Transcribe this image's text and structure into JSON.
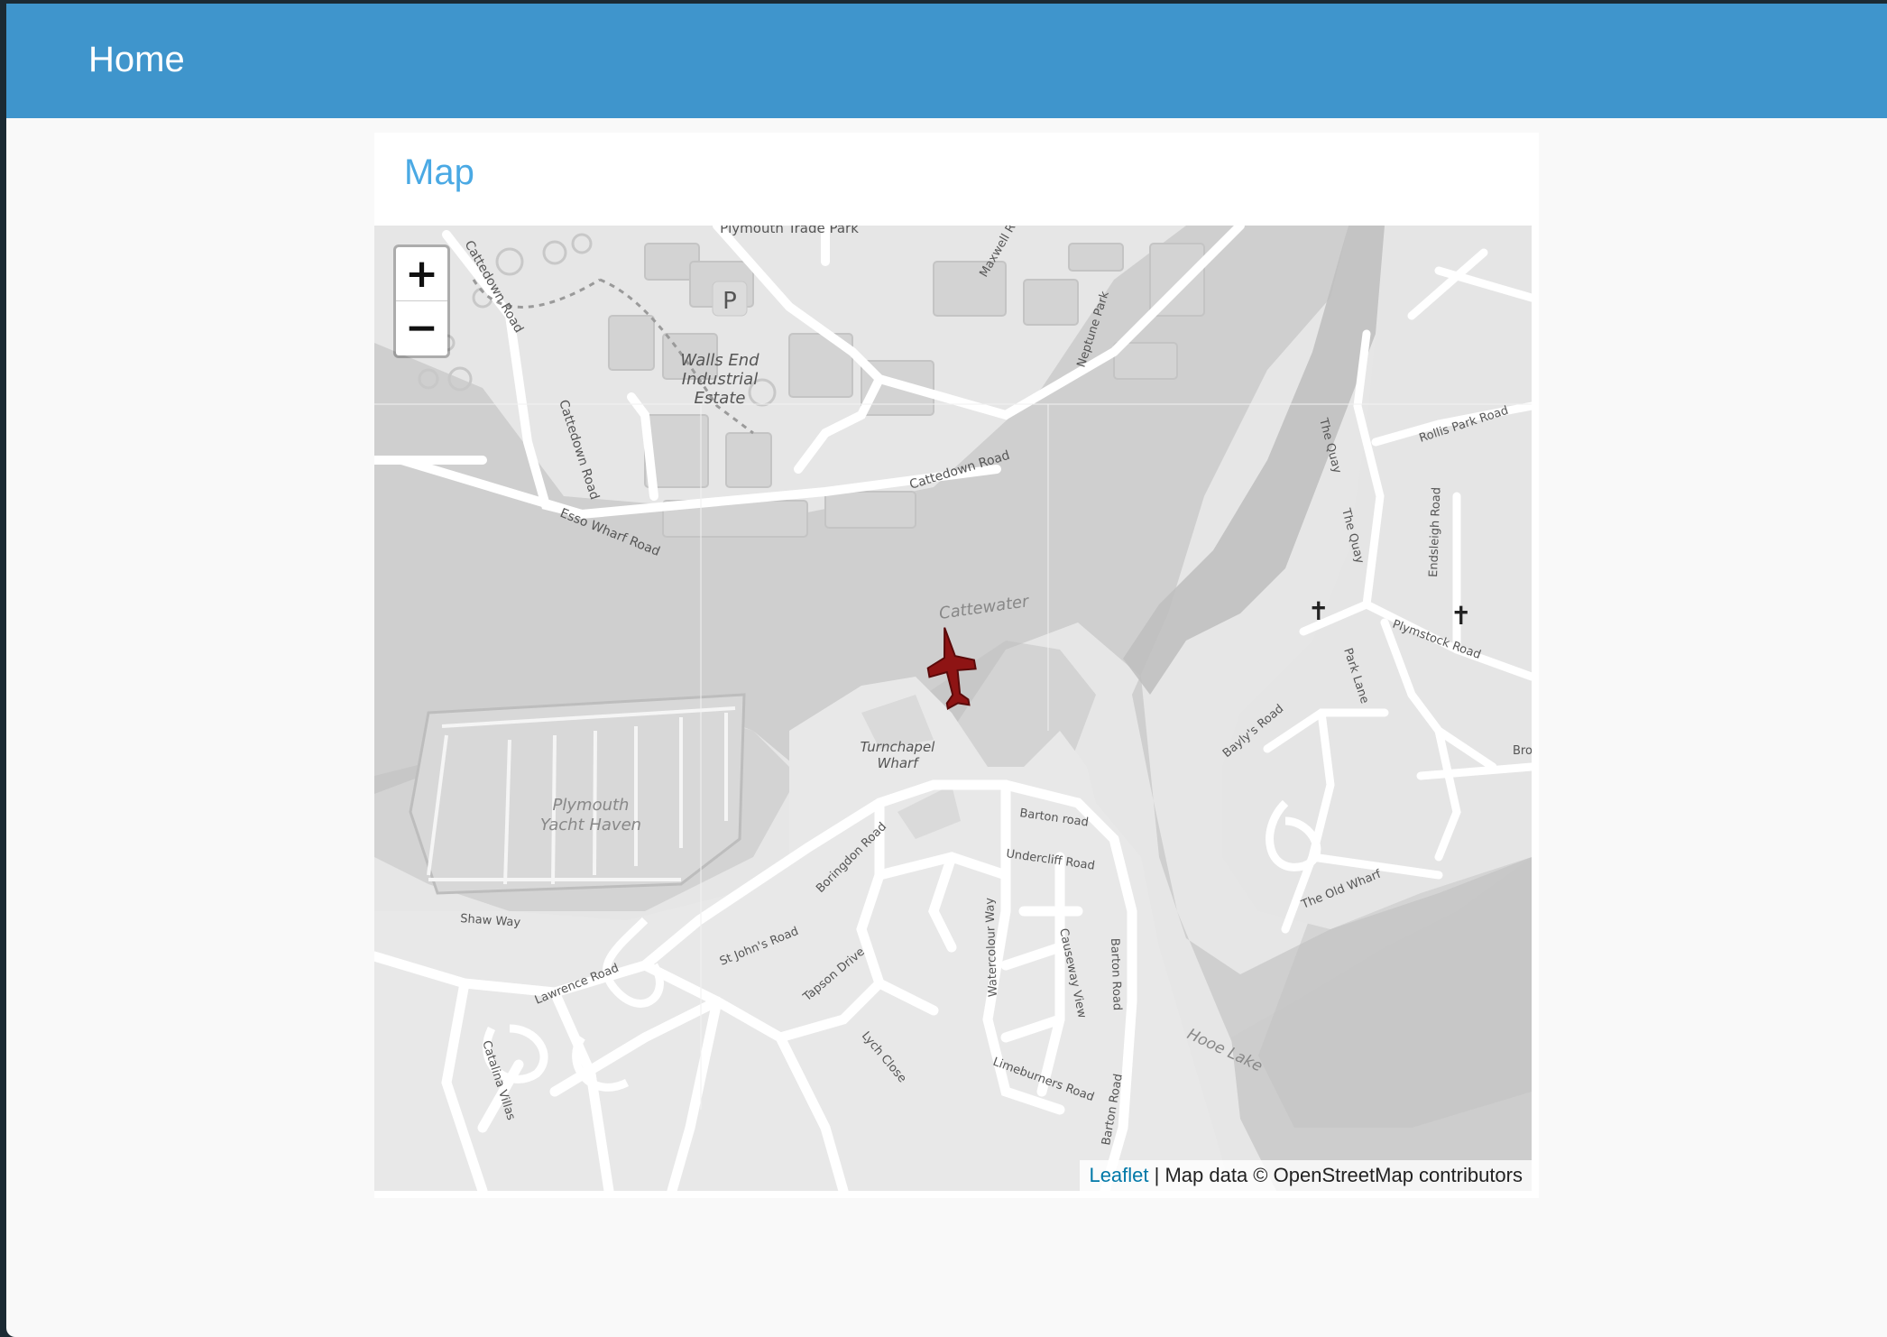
{
  "navbar": {
    "brand": "Home"
  },
  "panel": {
    "title": "Map"
  },
  "map": {
    "zoom_in": "+",
    "zoom_out": "−",
    "attribution": {
      "link": "Leaflet",
      "separator": " | ",
      "text": "Map data © OpenStreetMap contributors"
    },
    "labels": {
      "trade_park": "Plymouth Trade Park",
      "walls_end_1": "Walls End",
      "walls_end_2": "Industrial",
      "walls_end_3": "Estate",
      "cattedown_road": "Cattedown Road",
      "cattedown_road_2": "Cattedown Road",
      "cattedown_road_3": "Cattedown Road",
      "esso_wharf": "Esso Wharf Road",
      "maxwell": "Maxwell R",
      "neptune": "Neptune Park",
      "cattewater": "Cattewater",
      "turnchapel_1": "Turnchapel",
      "turnchapel_2": "Wharf",
      "yacht_1": "Plymouth",
      "yacht_2": "Yacht Haven",
      "the_quay": "The Quay",
      "the_quay_2": "The Quay",
      "rollis_park": "Rollis Park Road",
      "endsleigh": "Endsleigh Road",
      "plymstock": "Plymstock Road",
      "park_lane": "Park Lane",
      "baylys": "Bayly's Road",
      "barton_road": "Barton road",
      "barton_road_2": "Barton Road",
      "barton_road_3": "Barton Road",
      "undercliff": "Undercliff Road",
      "boringdon": "Boringdon Road",
      "shaw_way": "Shaw Way",
      "lawrence": "Lawrence Road",
      "st_johns": "St John's Road",
      "tapson": "Tapson Drive",
      "lych_close": "Lych Close",
      "watercolour": "Watercolour Way",
      "causeway": "Causeway View",
      "limeburners": "Limeburners Road",
      "catalina": "Catalina Villas",
      "old_wharf": "The Old Wharf",
      "hooe_lake": "Hooe Lake",
      "bro": "Bro",
      "parking": "P"
    }
  }
}
